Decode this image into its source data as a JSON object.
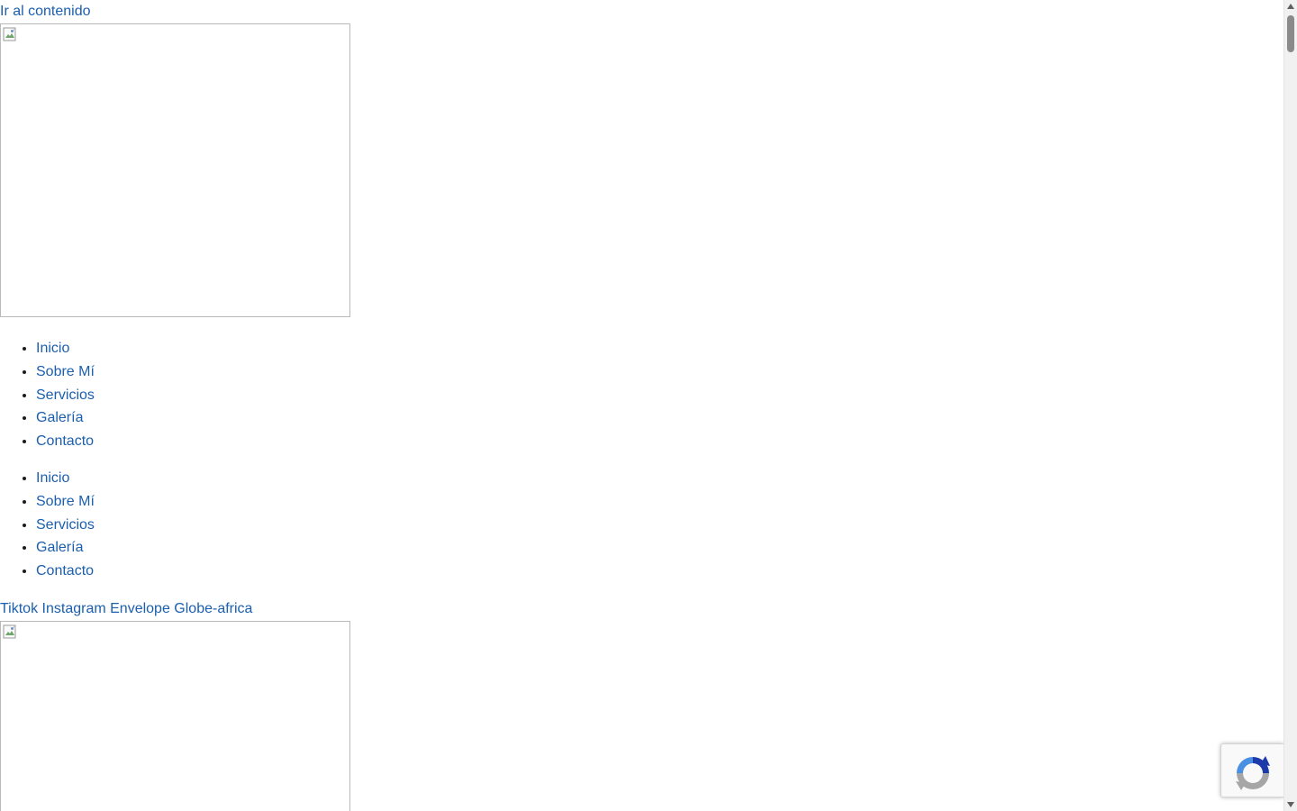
{
  "skip_link": {
    "label": "Ir al contenido"
  },
  "nav_primary": {
    "items": [
      {
        "label": "Inicio"
      },
      {
        "label": "Sobre Mí"
      },
      {
        "label": "Servicios"
      },
      {
        "label": "Galería"
      },
      {
        "label": "Contacto"
      }
    ]
  },
  "nav_secondary": {
    "items": [
      {
        "label": "Inicio"
      },
      {
        "label": "Sobre Mí"
      },
      {
        "label": "Servicios"
      },
      {
        "label": "Galería"
      },
      {
        "label": "Contacto"
      }
    ]
  },
  "social": {
    "links": [
      {
        "label": "Tiktok"
      },
      {
        "label": "Instagram"
      },
      {
        "label": "Envelope"
      },
      {
        "label": "Globe-africa"
      }
    ]
  },
  "colors": {
    "link": "#1b5fae",
    "recaptcha_blue": "#1c3aa9",
    "recaptcha_gray": "#a6a6a6"
  },
  "icons": {
    "broken_image": "broken-image-icon",
    "recaptcha": "recaptcha-icon"
  }
}
